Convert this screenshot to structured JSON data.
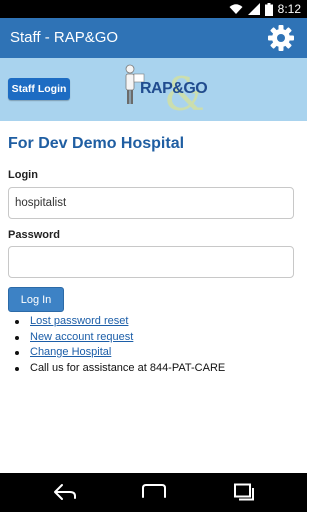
{
  "status_bar": {
    "time": "8:12"
  },
  "app_bar": {
    "title": "Staff - RAP&GO",
    "settings_icon": "gear-icon"
  },
  "header": {
    "staff_login_label": "Staff Login",
    "logo_text": "RAP&GO"
  },
  "page": {
    "heading": "For Dev Demo Hospital",
    "login_label": "Login",
    "login_value": "hospitalist",
    "password_label": "Password",
    "password_value": "",
    "login_button": "Log In",
    "links": [
      "Lost password reset",
      "New account request",
      "Change Hospital"
    ],
    "assistance_text": "Call us for assistance at 844-PAT-CARE"
  },
  "colors": {
    "action_bar": "#2f73b6",
    "header_band": "#a9d3ee",
    "button": "#3d82c5",
    "link": "#1c5ea8"
  }
}
